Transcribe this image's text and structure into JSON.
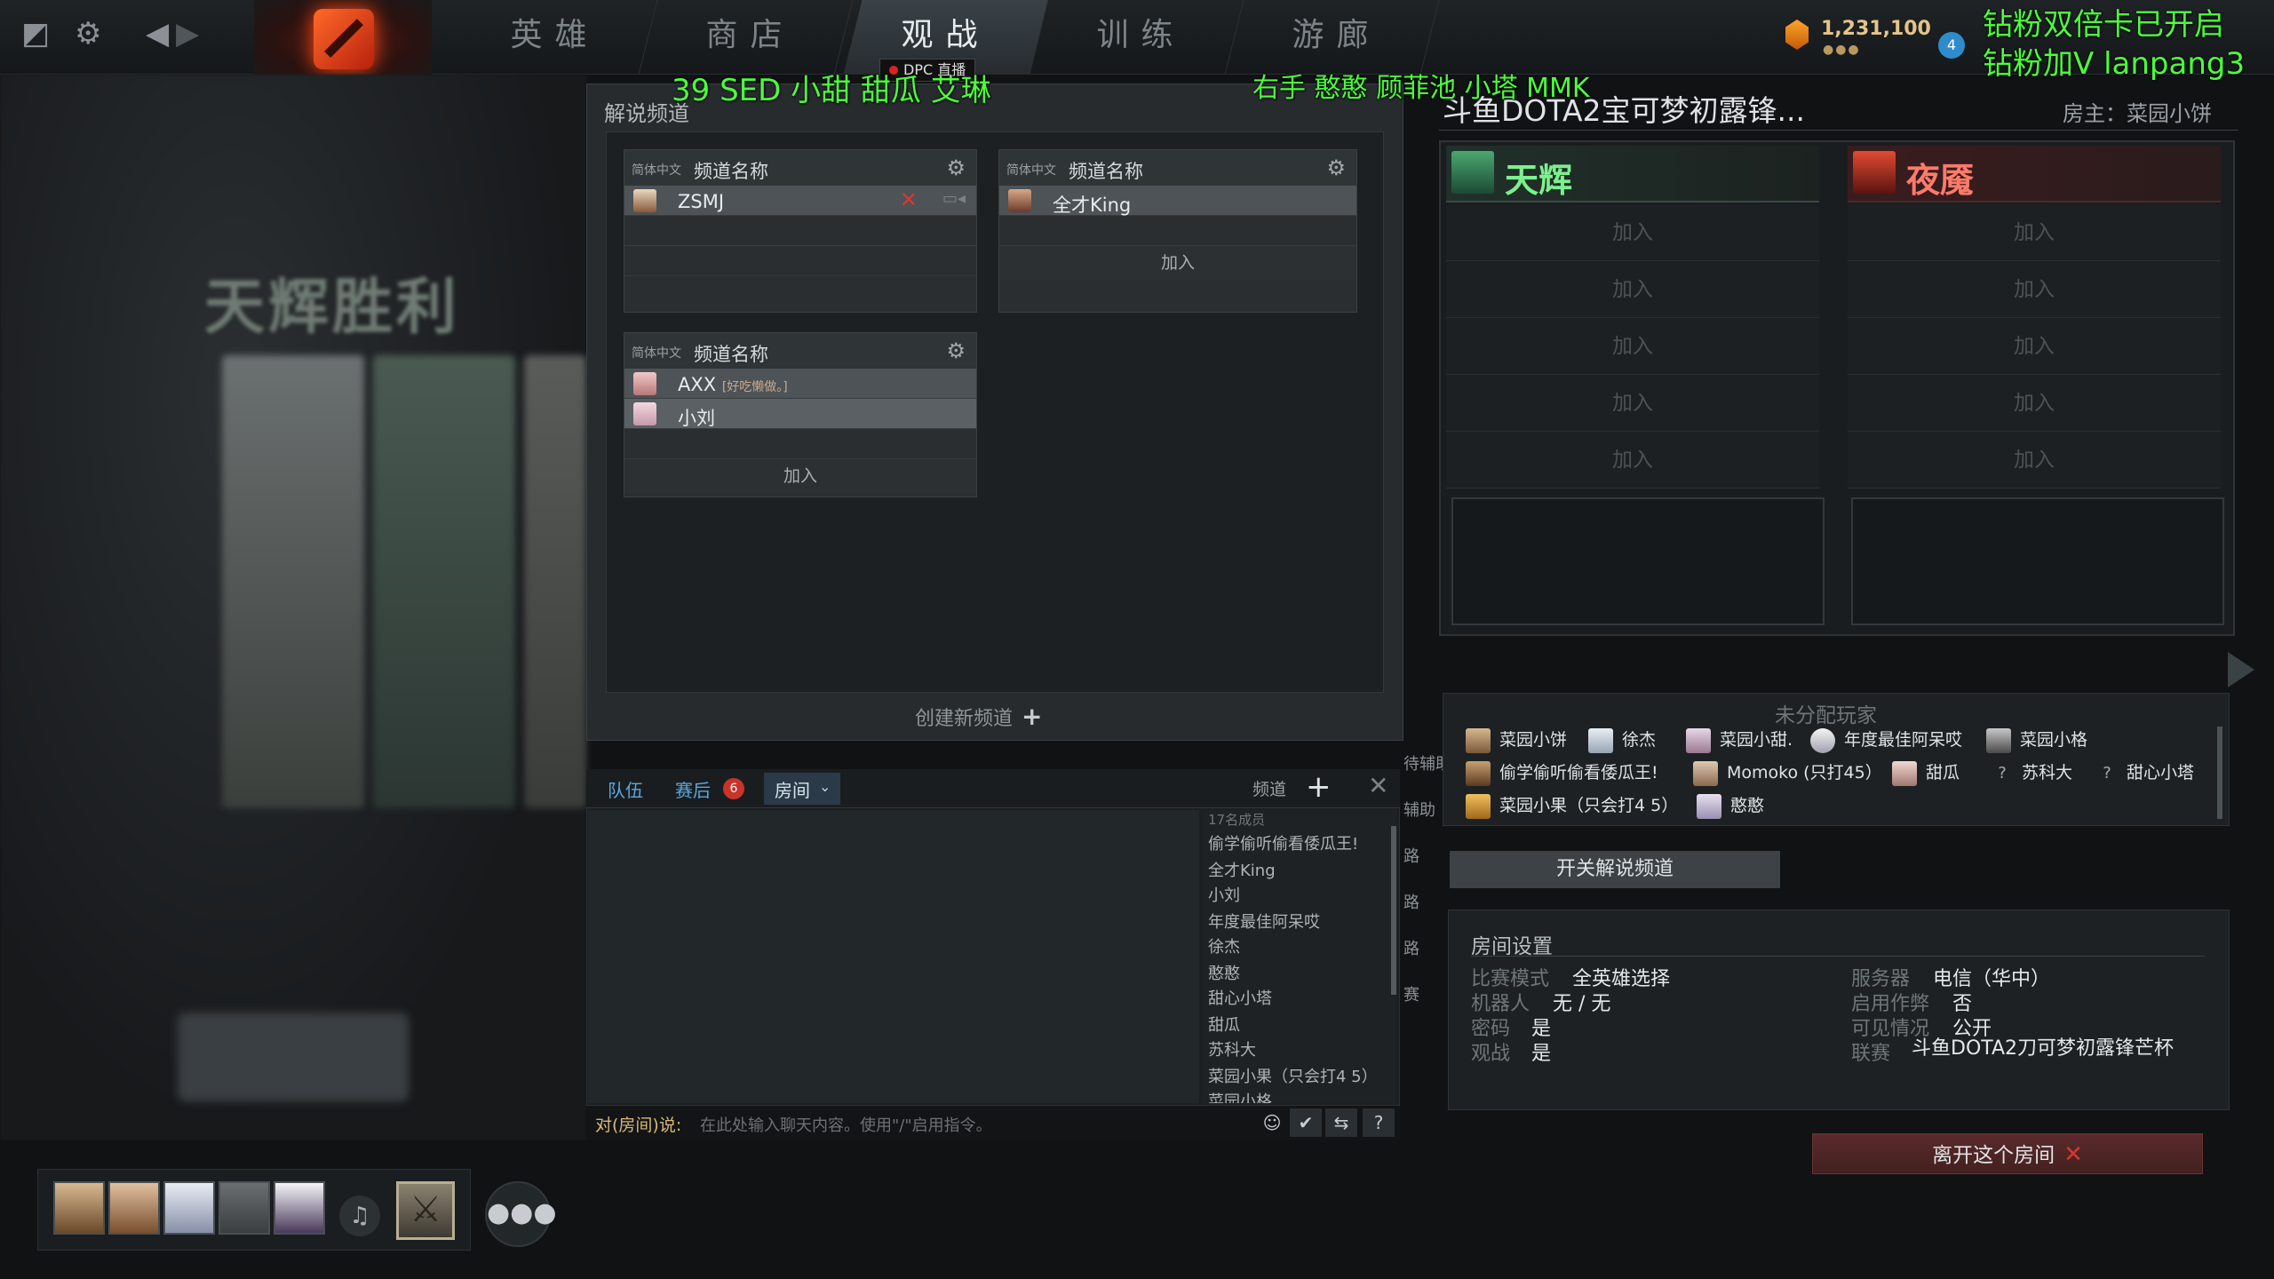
{
  "nav": {
    "tabs": [
      "英雄",
      "商店",
      "观战",
      "训练",
      "游廊"
    ],
    "active_tab": "观战",
    "dpc_badge": "DPC 直播",
    "currency": "1,231,100",
    "currency_dots": "●●●",
    "level": "4"
  },
  "overlay": {
    "top_left_text": "39 SED 小甜 甜瓜 艾琳",
    "top_mid_text": "右手 憨憨 顾菲池 小塔 MMK",
    "top_right_line1": "钻粉双倍卡已开启",
    "top_right_line2": "钻粉加V lanpang3"
  },
  "background": {
    "victory_text": "天辉胜利"
  },
  "channels": {
    "panel_title": "解说频道",
    "create_label": "创建新频道",
    "boxes": [
      {
        "lang": "简体中文",
        "name": "频道名称",
        "members": [
          {
            "name": "ZSMJ",
            "note": ""
          }
        ],
        "join": ""
      },
      {
        "lang": "简体中文",
        "name": "频道名称",
        "members": [
          {
            "name": "全才King",
            "note": ""
          }
        ],
        "join": "加入"
      },
      {
        "lang": "简体中文",
        "name": "频道名称",
        "members": [
          {
            "name": "AXX",
            "note": "[好吃懒做。]"
          },
          {
            "name": "小刘",
            "note": ""
          }
        ],
        "join": "加入"
      }
    ]
  },
  "chat": {
    "tabs": [
      "队伍",
      "赛后",
      "房间"
    ],
    "post_game_badge": "6",
    "channel_label": "频道",
    "member_count": "17名成员",
    "members": [
      "偷学偷听偷看倭瓜王!",
      "全才King",
      "小刘",
      "年度最佳阿呆哎",
      "徐杰",
      "憨憨",
      "甜心小塔",
      "甜瓜",
      "苏科大",
      "菜园小果（只会打4 5）",
      "菜园小格"
    ],
    "input_prefix": "对(房间)说:",
    "input_placeholder": "在此处输入聊天内容。使用\"/\"启用指令。",
    "side_labels": [
      "待辅助",
      "辅助",
      "路",
      "路",
      "路",
      "赛"
    ]
  },
  "lobby": {
    "title": "斗鱼DOTA2宝可梦初露锋...",
    "host": "房主：菜园小饼",
    "radiant": "天辉",
    "dire": "夜魇",
    "join_label": "加入",
    "unassigned_title": "未分配玩家",
    "unassigned": [
      [
        "菜园小饼",
        "徐杰",
        "菜园小甜.",
        "年度最佳阿呆哎",
        "菜园小格"
      ],
      [
        "偷学偷听偷看倭瓜王!",
        "Momoko (只打45）",
        "甜瓜",
        "苏科大",
        "甜心小塔"
      ],
      [
        "菜园小果（只会打4 5）",
        "憨憨"
      ]
    ],
    "toggle_channel": "开关解说频道",
    "settings_title": "房间设置",
    "settings_left": [
      {
        "k": "比赛模式",
        "v": "全英雄选择"
      },
      {
        "k": "机器人",
        "v": "无 / 无"
      },
      {
        "k": "密码",
        "v": "是"
      },
      {
        "k": "观战",
        "v": "是"
      }
    ],
    "settings_right": [
      {
        "k": "服务器",
        "v": "电信（华中）"
      },
      {
        "k": "启用作弊",
        "v": "否"
      },
      {
        "k": "可见情况",
        "v": "公开"
      },
      {
        "k": "联赛",
        "v": "斗鱼DOTA2刀可梦初露锋芒杯"
      }
    ],
    "leave_label": "离开这个房间"
  }
}
